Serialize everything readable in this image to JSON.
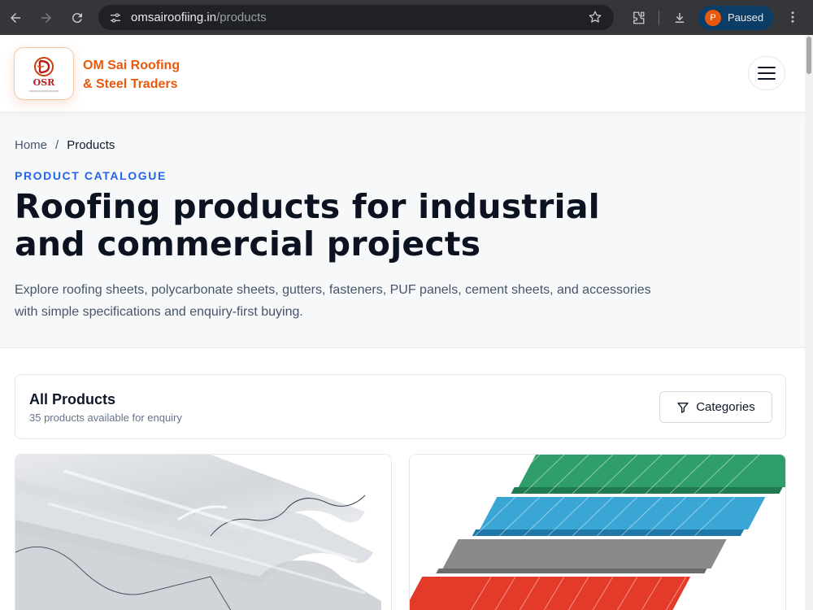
{
  "browser": {
    "url_host": "omsairoofiing.in",
    "url_path": "/products",
    "profile_initial": "P",
    "profile_status": "Paused",
    "icons": [
      "back-arrow-icon",
      "forward-arrow-icon",
      "reload-icon",
      "site-settings-icon",
      "star-icon",
      "extensions-icon",
      "download-icon",
      "more-vert-icon"
    ]
  },
  "header": {
    "logo_text": "OSR",
    "brand_line1": "OM Sai Roofing",
    "brand_line2": "& Steel Traders",
    "brand_color": "#e8590c"
  },
  "breadcrumb": {
    "home": "Home",
    "separator": "/",
    "current": "Products"
  },
  "hero": {
    "eyebrow": "PRODUCT CATALOGUE",
    "title_line1": "Roofing products for industrial",
    "title_line2": "and commercial projects",
    "lead": "Explore roofing sheets, polycarbonate sheets, gutters, fasteners, PUF panels, cement sheets, and accessories with simple specifications and enquiry-first buying.",
    "accent_color": "#2563eb"
  },
  "products_bar": {
    "heading": "All Products",
    "count_text": "35 products available for enquiry",
    "categories_label": "Categories"
  }
}
